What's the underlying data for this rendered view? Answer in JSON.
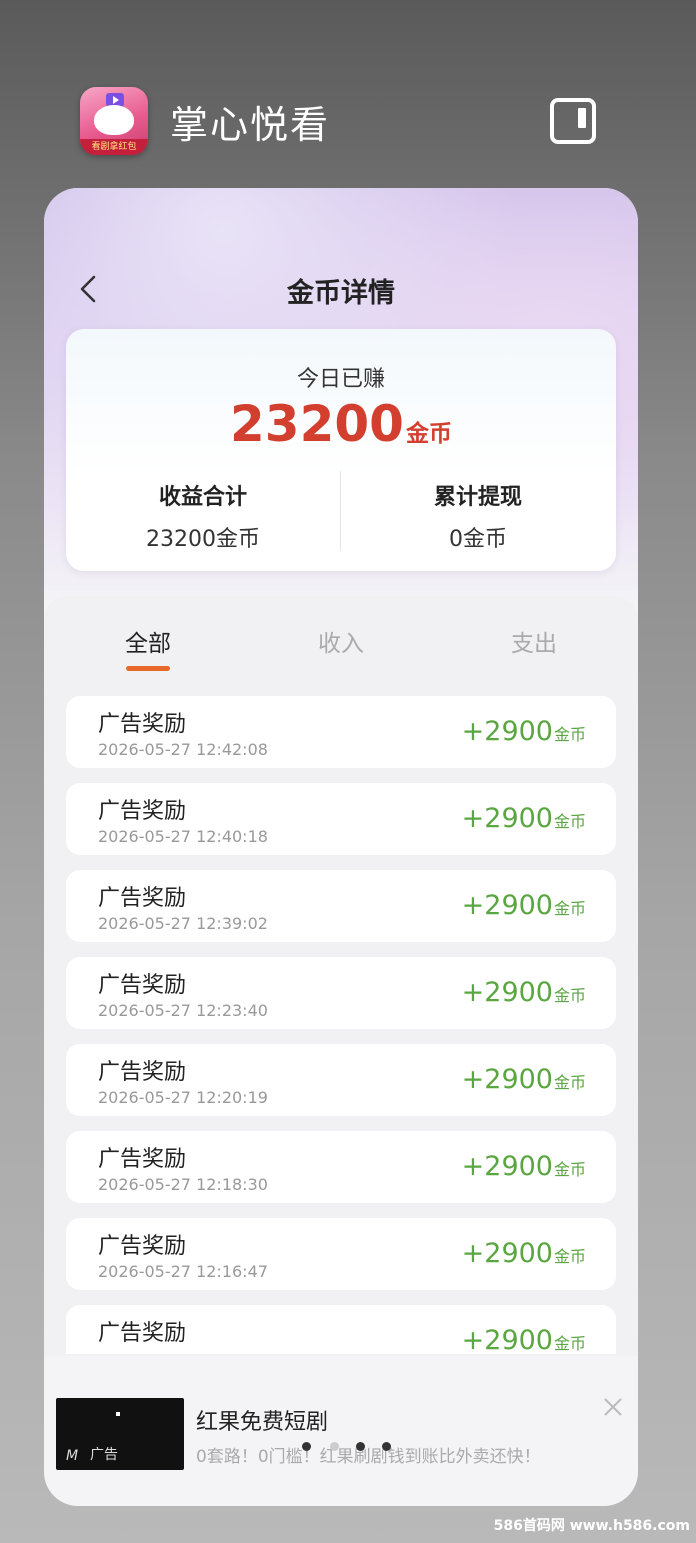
{
  "app": {
    "name": "掌心悦看",
    "icon_badge": "看剧拿红包"
  },
  "page": {
    "title": "金币详情"
  },
  "summary": {
    "today_label": "今日已赚",
    "today_value": "23200",
    "today_unit": "金币",
    "total_label": "收益合计",
    "total_value": "23200金币",
    "withdraw_label": "累计提现",
    "withdraw_value": "0金币"
  },
  "tabs": [
    {
      "label": "全部",
      "active": true
    },
    {
      "label": "收入",
      "active": false
    },
    {
      "label": "支出",
      "active": false
    }
  ],
  "transactions": [
    {
      "title": "广告奖励",
      "time": "2026-05-27 12:42:08",
      "amount": "+2900",
      "unit": "金币"
    },
    {
      "title": "广告奖励",
      "time": "2026-05-27 12:40:18",
      "amount": "+2900",
      "unit": "金币"
    },
    {
      "title": "广告奖励",
      "time": "2026-05-27 12:39:02",
      "amount": "+2900",
      "unit": "金币"
    },
    {
      "title": "广告奖励",
      "time": "2026-05-27 12:23:40",
      "amount": "+2900",
      "unit": "金币"
    },
    {
      "title": "广告奖励",
      "time": "2026-05-27 12:20:19",
      "amount": "+2900",
      "unit": "金币"
    },
    {
      "title": "广告奖励",
      "time": "2026-05-27 12:18:30",
      "amount": "+2900",
      "unit": "金币"
    },
    {
      "title": "广告奖励",
      "time": "2026-05-27 12:16:47",
      "amount": "+2900",
      "unit": "金币"
    },
    {
      "title": "广告奖励",
      "time": "",
      "amount": "+2900",
      "unit": "金币"
    }
  ],
  "ad": {
    "thumb_tag": "广告",
    "title": "红果免费短剧",
    "description": "0套路！0门槛！红果刷剧钱到账比外卖还快！"
  },
  "watermark": "586首码网 www.h586.com",
  "colors": {
    "accent": "#e86a2a",
    "today_value": "#d23f2f",
    "amount": "#5aa641"
  },
  "icons": {
    "back": "chevron-left-icon",
    "window": "window-icon",
    "close": "close-icon"
  }
}
